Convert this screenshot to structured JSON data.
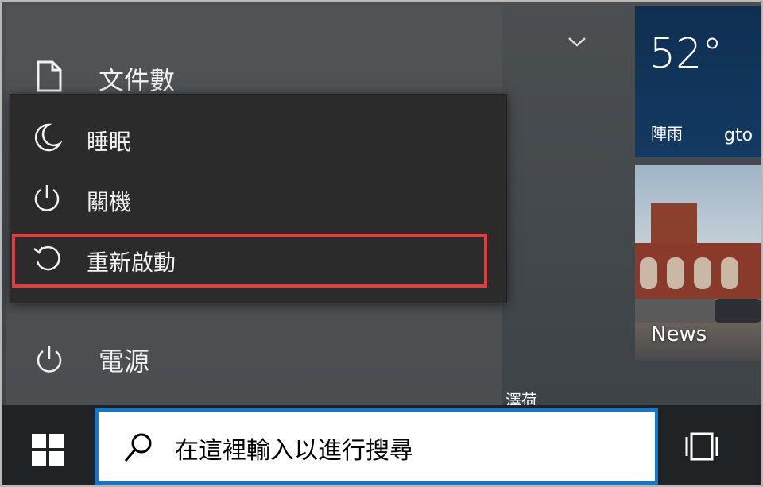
{
  "start_menu": {
    "documents_label": "文件數",
    "power_label": "電源",
    "power_menu": {
      "items": [
        {
          "label": "睡眠",
          "icon": "moon-icon"
        },
        {
          "label": "關機",
          "icon": "power-icon"
        },
        {
          "label": "重新啟動",
          "icon": "restart-icon"
        }
      ]
    },
    "collapse_icon": "chevron-down-icon"
  },
  "tiles": {
    "weather": {
      "temperature": "52°",
      "condition": "陣雨",
      "city": "gto"
    },
    "news": {
      "label": "News"
    },
    "bottom_label": "澤荷"
  },
  "taskbar": {
    "search_placeholder": "在這裡輸入以進行搜尋",
    "start_icon": "windows-logo-icon",
    "task_view_icon": "task-view-icon"
  },
  "colors": {
    "highlight_border": "#e23c3c",
    "search_border": "#0a79d8",
    "taskbar": "#1f2326",
    "weather_tile": "#133a62"
  }
}
